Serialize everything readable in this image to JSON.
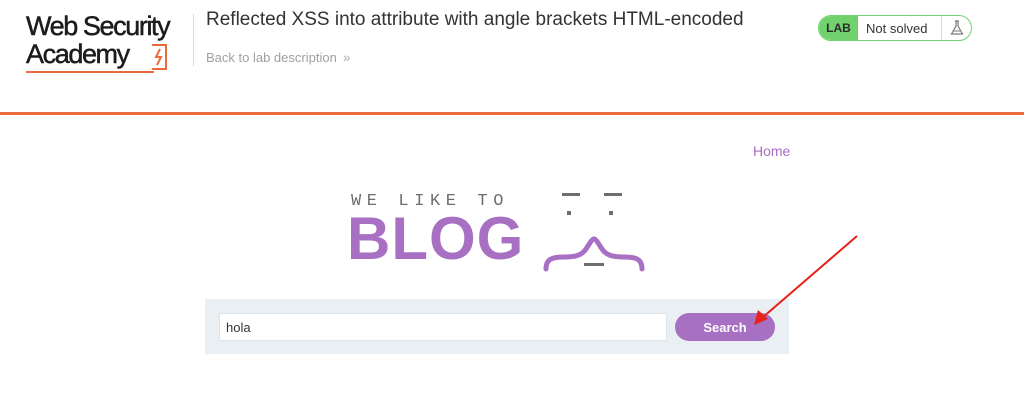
{
  "header": {
    "logo": {
      "line1": "Web Security",
      "line2": "Academy"
    },
    "lab_title": "Reflected XSS into attribute with angle brackets HTML-encoded",
    "back_link": "Back to lab description",
    "status": {
      "badge": "LAB",
      "text": "Not solved",
      "icon": "flask-icon"
    }
  },
  "blog": {
    "nav": {
      "home": "Home"
    },
    "logo": {
      "tagline": "WE LIKE TO",
      "word": "BLOG"
    },
    "search": {
      "value": "hola",
      "button_label": "Search"
    }
  },
  "colors": {
    "accent_orange": "#ec6b3e",
    "brand_purple": "#a870c2",
    "status_green": "#70d16d",
    "annotation_red": "#e8221b"
  }
}
